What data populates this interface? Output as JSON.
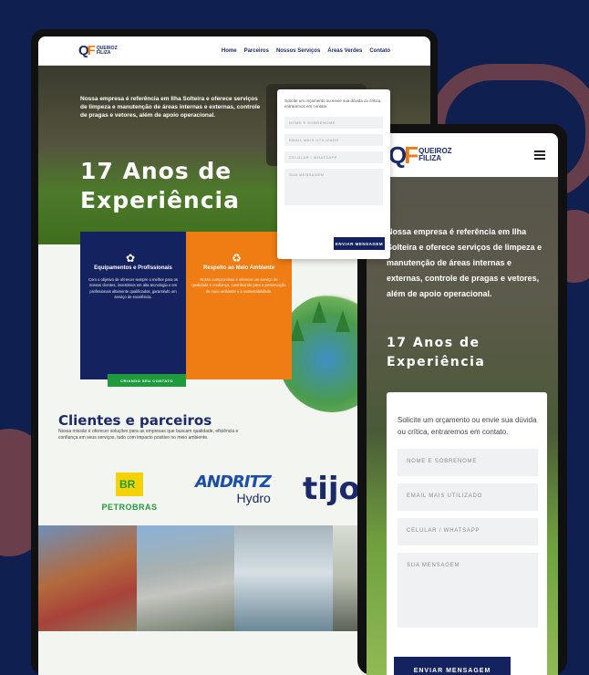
{
  "brand": {
    "mark_q": "Q",
    "mark_f": "F",
    "name_line1": "QUEIROZ",
    "name_line2": "FILIZA"
  },
  "nav": {
    "items": [
      {
        "label": "Home"
      },
      {
        "label": "Parceiros"
      },
      {
        "label": "Nossos Serviços"
      },
      {
        "label": "Áreas Verdes"
      },
      {
        "label": "Contato"
      }
    ]
  },
  "hero": {
    "intro_desktop": "Nossa empresa é referência em Ilha Solteira e oferece serviços de limpeza e manutenção de áreas internas e externas, controle de pragas e vetores, além de apoio operacional.",
    "intro_mobile": "Nossa empresa é referência em Ilha Solteira e oferece serviços de limpeza e manutenção de áreas internas e externas, controle de pragas e vetores, além de apoio operacional.",
    "title_line1": "17 Anos de",
    "title_line2": "Experiência"
  },
  "form": {
    "intro": "Solicite um orçamento ou envie sua dúvida ou crítica, entraremos em contato.",
    "name_placeholder": "NOME E SOBRENOME",
    "email_placeholder": "EMAIL MAIS UTILIZADO",
    "phone_placeholder": "CELULAR / WHATSAPP",
    "message_placeholder": "SUA MENSAGEM",
    "submit_label": "ENVIAR MENSAGEM"
  },
  "cards": [
    {
      "title": "Equipamentos e Profissionais",
      "text": "Com o objetivo de oferecer sempre o melhor para os nossos clientes, investimos em alta tecnologia e em profissionais altamente qualificados, garantindo um serviço de excelência."
    },
    {
      "title": "Respeito ao Meio Ambiente",
      "text": "Nosso compromisso é oferecer um serviço de qualidade e confiança, contribuindo para a preservação do meio ambiente e a sustentabilidade."
    }
  ],
  "cards_button": "CRIANDO SEU CONTATO",
  "clients": {
    "title": "Clientes e parceiros",
    "text": "Nossa missão é oferecer soluções para as empresas que buscam qualidade, eficiência e confiança em seus serviços, tudo com impacto positivo no meio ambiente.",
    "petrobras_mark": "BR",
    "petrobras_name": "PETROBRAS",
    "andritz_name": "ANDRITZ",
    "andritz_sub": "Hydro",
    "tijo_name": "tijo"
  },
  "colors": {
    "navy": "#14235f",
    "orange": "#f07d14",
    "green": "#1f9a3c",
    "bg": "#0f1f4f"
  },
  "icons": [
    "hamburger-menu-icon",
    "plant-icon",
    "recycle-icon"
  ]
}
